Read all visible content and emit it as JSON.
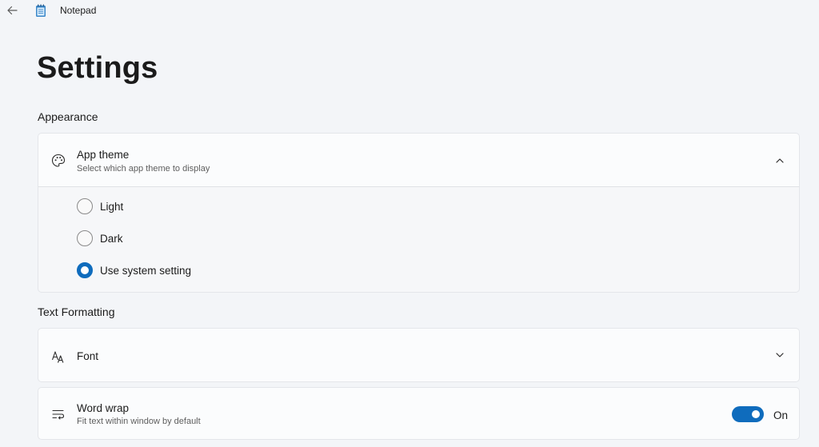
{
  "titlebar": {
    "back_icon": "back-arrow-icon",
    "app_icon": "notepad-icon",
    "app_name": "Notepad"
  },
  "page": {
    "title": "Settings"
  },
  "appearance": {
    "section_label": "Appearance",
    "app_theme": {
      "icon": "palette-icon",
      "title": "App theme",
      "subtitle": "Select which app theme to display",
      "expanded": true,
      "options": [
        {
          "label": "Light",
          "selected": false
        },
        {
          "label": "Dark",
          "selected": false
        },
        {
          "label": "Use system setting",
          "selected": true
        }
      ]
    }
  },
  "text_formatting": {
    "section_label": "Text Formatting",
    "font": {
      "icon": "font-icon",
      "title": "Font"
    },
    "word_wrap": {
      "icon": "word-wrap-icon",
      "title": "Word wrap",
      "subtitle": "Fit text within window by default",
      "toggle_state": "On",
      "enabled": true
    }
  },
  "colors": {
    "accent": "#0f6cbd",
    "background": "#f3f5f8",
    "card": "#fbfcfd"
  }
}
